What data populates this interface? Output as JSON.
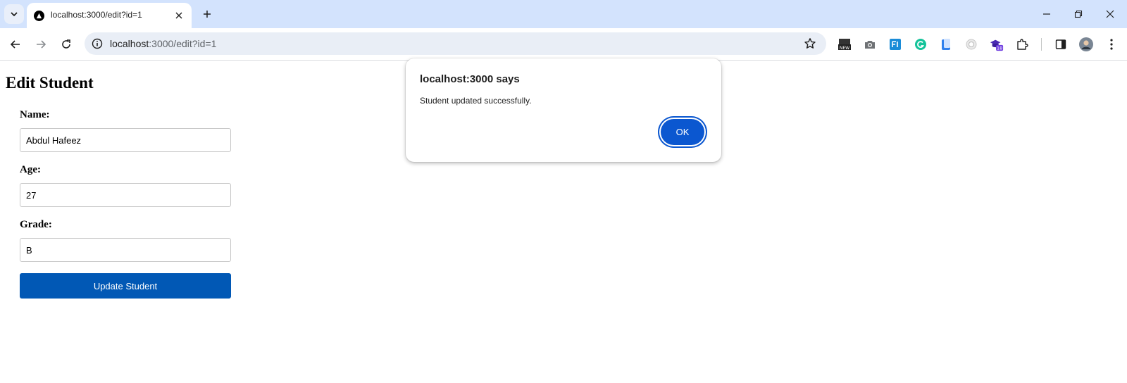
{
  "browser": {
    "tab_title": "localhost:3000/edit?id=1",
    "url_host": "localhost",
    "url_rest": ":3000/edit?id=1",
    "extension_badge": "18"
  },
  "page": {
    "heading": "Edit Student",
    "name_label": "Name:",
    "name_value": "Abdul Hafeez",
    "age_label": "Age:",
    "age_value": "27",
    "grade_label": "Grade:",
    "grade_value": "B",
    "submit_label": "Update Student"
  },
  "dialog": {
    "title": "localhost:3000 says",
    "message": "Student updated successfully.",
    "ok_label": "OK"
  },
  "colors": {
    "tabbar_bg": "#d3e3fd",
    "submit_bg": "#0158b5",
    "dialog_button": "#0b57d0"
  }
}
